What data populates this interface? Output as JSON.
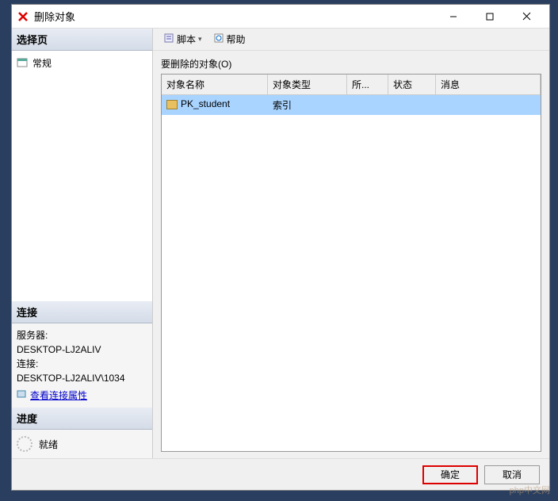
{
  "window": {
    "title": "删除对象"
  },
  "sidebar": {
    "select_page_header": "选择页",
    "general_label": "常规",
    "connection_header": "连接",
    "server_label": "服务器:",
    "server_value": "DESKTOP-LJ2ALIV",
    "conn_label": "连接:",
    "conn_value": "DESKTOP-LJ2ALIV\\1034",
    "view_props_label": "查看连接属性",
    "progress_header": "进度",
    "progress_status": "就绪"
  },
  "toolbar": {
    "script_label": "脚本",
    "help_label": "帮助"
  },
  "main": {
    "grid_label": "要删除的对象(O)",
    "columns": {
      "c1": "对象名称",
      "c2": "对象类型",
      "c3": "所...",
      "c4": "状态",
      "c5": "消息"
    },
    "row": {
      "name": "PK_student",
      "type": "索引",
      "owner": "",
      "status": "",
      "message": ""
    }
  },
  "footer": {
    "ok_label": "确定",
    "cancel_label": "取消"
  },
  "watermark": "php中文网"
}
